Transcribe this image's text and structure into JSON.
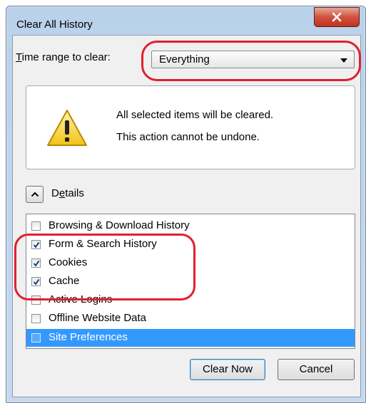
{
  "window": {
    "title": "Clear All History"
  },
  "time_range": {
    "label_accesskey": "T",
    "label_rest": "ime range to clear:",
    "selected": "Everything"
  },
  "warning": {
    "line1": "All selected items will be cleared.",
    "line2": "This action cannot be undone."
  },
  "details": {
    "label_first": "D",
    "label_accesskey": "e",
    "label_rest": "tails",
    "expanded": true
  },
  "items": [
    {
      "label": "Browsing & Download History",
      "checked": false,
      "selected": false
    },
    {
      "label": "Form & Search History",
      "checked": true,
      "selected": false
    },
    {
      "label": "Cookies",
      "checked": true,
      "selected": false
    },
    {
      "label": "Cache",
      "checked": true,
      "selected": false
    },
    {
      "label": "Active Logins",
      "checked": false,
      "selected": false
    },
    {
      "label": "Offline Website Data",
      "checked": false,
      "selected": false
    },
    {
      "label": "Site Preferences",
      "checked": false,
      "selected": true
    }
  ],
  "buttons": {
    "clear_now": "Clear Now",
    "cancel": "Cancel"
  },
  "icons": {
    "close": "close-icon",
    "warning": "warning-icon",
    "chevron": "chevron-up-icon",
    "check": "checkmark-icon"
  },
  "colors": {
    "selection": "#3399ff",
    "annotation": "#e0202f",
    "close_button": "#c7402c"
  }
}
